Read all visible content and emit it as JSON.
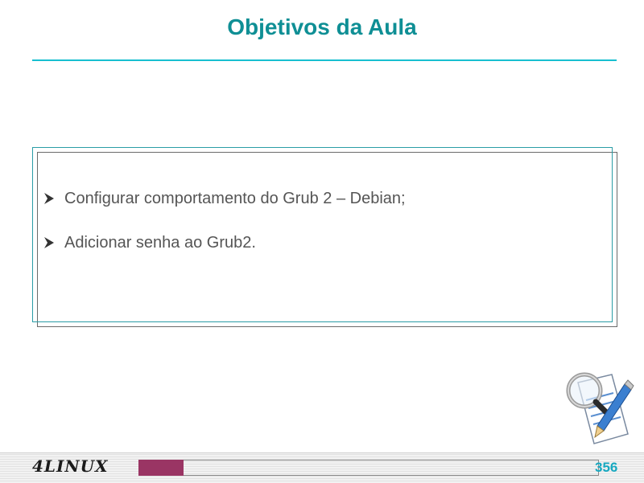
{
  "slide": {
    "title": "Objetivos da Aula",
    "bullets": [
      "Configurar comportamento do Grub 2 – Debian;",
      "Adicionar senha ao Grub2."
    ]
  },
  "footer": {
    "logo": "4LINUX",
    "page_number": "356"
  },
  "colors": {
    "title": "#0f8f95",
    "rule": "#17bfd0",
    "accent": "#9a3564",
    "page_number": "#17a8c0"
  },
  "icons": {
    "bullet": "arrowhead-bullet-icon",
    "clipart": "magnifier-pen-document-icon"
  }
}
